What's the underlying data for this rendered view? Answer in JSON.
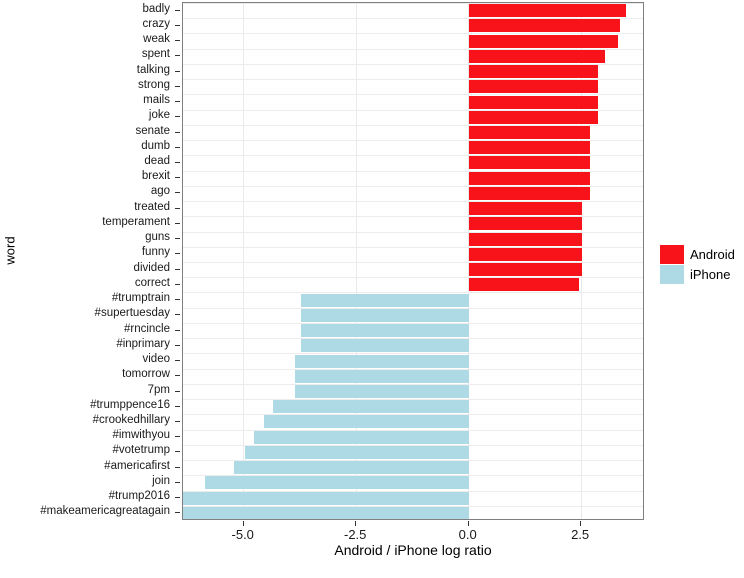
{
  "chart_data": {
    "type": "bar",
    "orientation": "horizontal",
    "title": "",
    "xlabel": "Android / iPhone log ratio",
    "ylabel": "word",
    "xlim": [
      -6.35,
      3.92
    ],
    "xticks": [
      -5.0,
      -2.5,
      0.0,
      2.5
    ],
    "xtick_labels": [
      "-5.0",
      "-2.5",
      "0.0",
      "2.5"
    ],
    "grid": true,
    "legend_position": "right",
    "colors": {
      "android": "#F8131A",
      "iphone": "#AEDAE6",
      "panel_border": "#7f7f7f",
      "gridline": "#e9e9e9",
      "background": "#ffffff"
    },
    "legend": [
      {
        "label": "Android",
        "color": "#F8131A"
      },
      {
        "label": "iPhone",
        "color": "#AEDAE6"
      }
    ],
    "categories": [
      "badly",
      "crazy",
      "weak",
      "spent",
      "talking",
      "strong",
      "mails",
      "joke",
      "senate",
      "dumb",
      "dead",
      "brexit",
      "ago",
      "treated",
      "temperament",
      "guns",
      "funny",
      "divided",
      "correct",
      "#trumptrain",
      "#supertuesday",
      "#rncincle",
      "#inprimary",
      "video",
      "tomorrow",
      "7pm",
      "#trumppence16",
      "#crookedhillary",
      "#imwithyou",
      "#votetrump",
      "#americafirst",
      "join",
      "#trump2016",
      "#makeamericagreatagain"
    ],
    "values": [
      3.5,
      3.36,
      3.31,
      3.04,
      2.87,
      2.87,
      2.87,
      2.87,
      2.7,
      2.7,
      2.7,
      2.7,
      2.7,
      2.52,
      2.52,
      2.52,
      2.52,
      2.52,
      2.45,
      -3.72,
      -3.72,
      -3.72,
      -3.72,
      -3.85,
      -3.85,
      -3.85,
      -4.34,
      -4.56,
      -4.78,
      -4.98,
      -5.22,
      -5.86,
      -6.86,
      -7.03
    ],
    "groups": [
      "Android",
      "Android",
      "Android",
      "Android",
      "Android",
      "Android",
      "Android",
      "Android",
      "Android",
      "Android",
      "Android",
      "Android",
      "Android",
      "Android",
      "Android",
      "Android",
      "Android",
      "Android",
      "Android",
      "iPhone",
      "iPhone",
      "iPhone",
      "iPhone",
      "iPhone",
      "iPhone",
      "iPhone",
      "iPhone",
      "iPhone",
      "iPhone",
      "iPhone",
      "iPhone",
      "iPhone",
      "iPhone",
      "iPhone"
    ]
  }
}
